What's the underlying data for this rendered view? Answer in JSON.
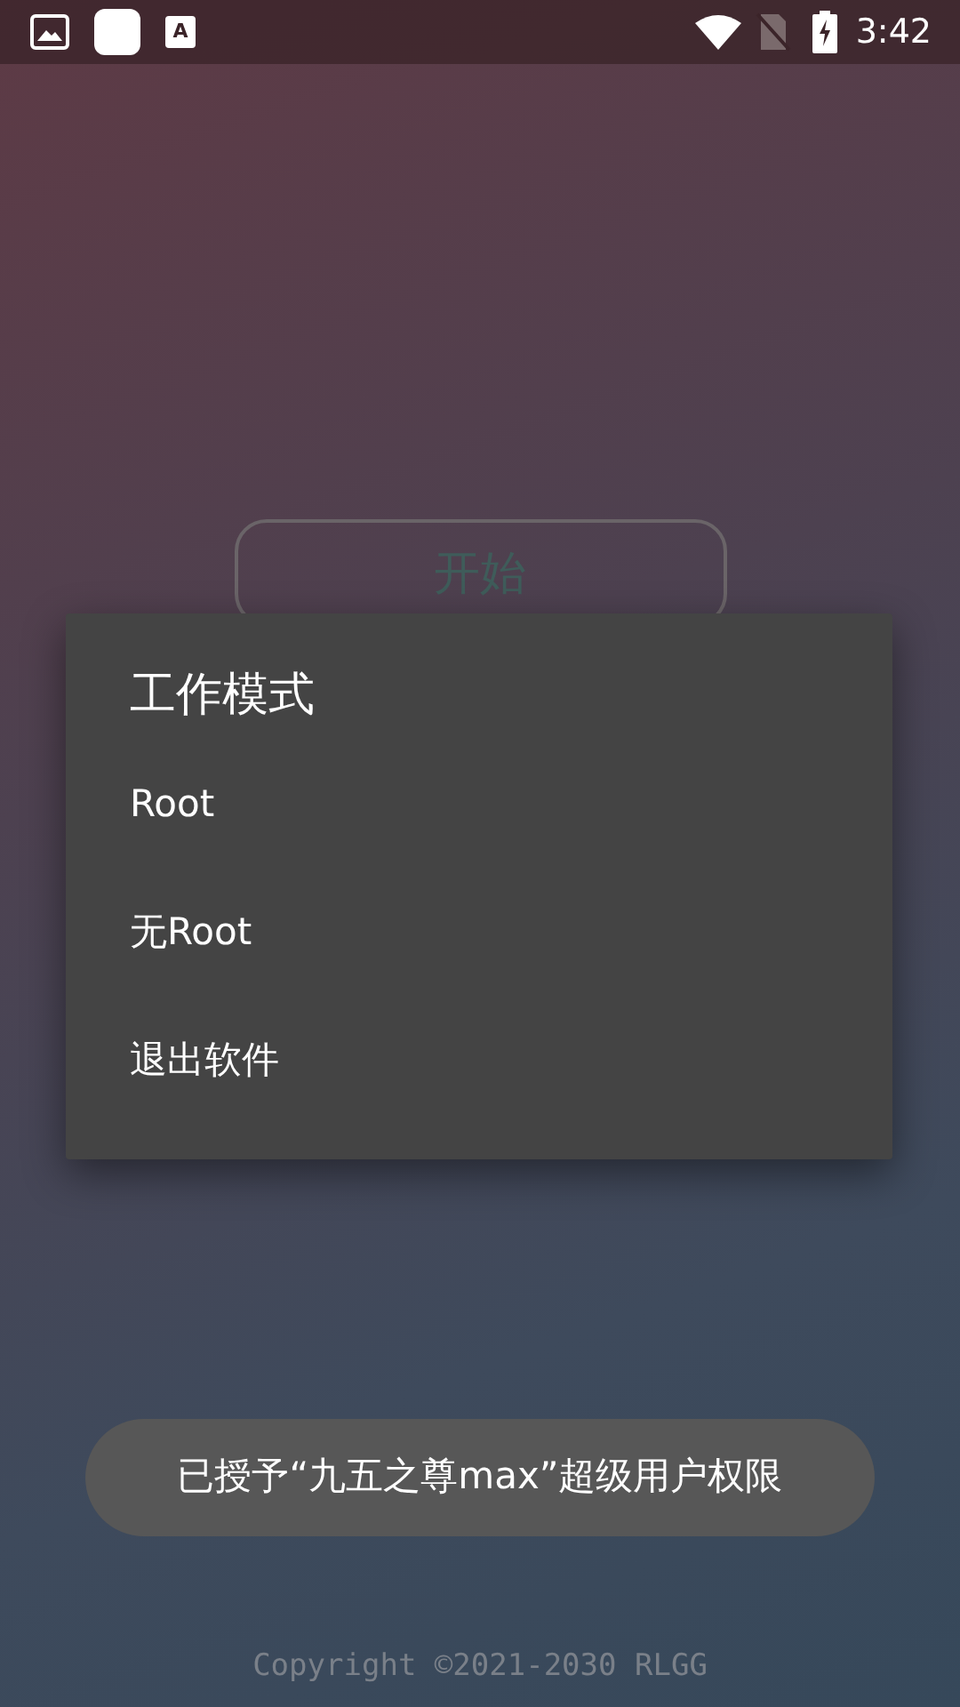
{
  "status_bar": {
    "time": "3:42",
    "notification_icon_text": "A"
  },
  "start_button": {
    "label": "开始"
  },
  "dialog": {
    "title": "工作模式",
    "options": [
      {
        "label": "Root"
      },
      {
        "label": "无Root"
      },
      {
        "label": "退出软件"
      }
    ]
  },
  "toast": {
    "text": "已授予“九五之尊max”超级用户权限"
  },
  "footer": {
    "copyright": "Copyright ©2021-2030 RLGG"
  }
}
